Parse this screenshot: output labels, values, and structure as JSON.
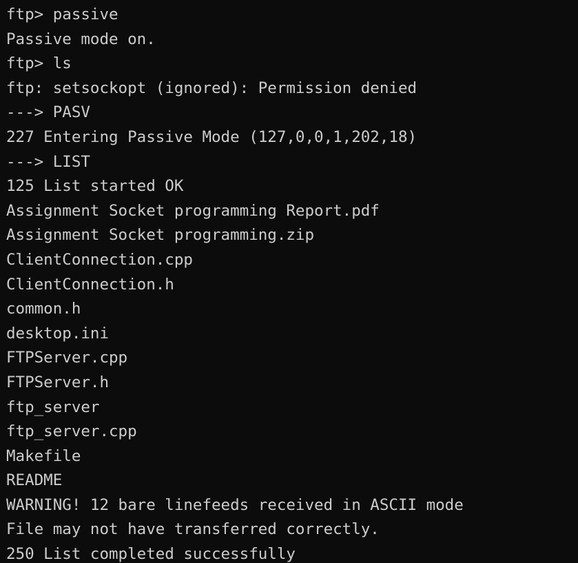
{
  "terminal": {
    "lines": [
      "ftp> passive",
      "Passive mode on.",
      "ftp> ls",
      "ftp: setsockopt (ignored): Permission denied",
      "---> PASV",
      "227 Entering Passive Mode (127,0,0,1,202,18)",
      "---> LIST",
      "125 List started OK",
      "Assignment Socket programming Report.pdf",
      "Assignment Socket programming.zip",
      "ClientConnection.cpp",
      "ClientConnection.h",
      "common.h",
      "desktop.ini",
      "FTPServer.cpp",
      "FTPServer.h",
      "ftp_server",
      "ftp_server.cpp",
      "Makefile",
      "README",
      "WARNING! 12 bare linefeeds received in ASCII mode",
      "File may not have transferred correctly.",
      "250 List completed successfully"
    ],
    "colors": {
      "background": "#0c0c0c",
      "foreground": "#cccccc"
    }
  }
}
